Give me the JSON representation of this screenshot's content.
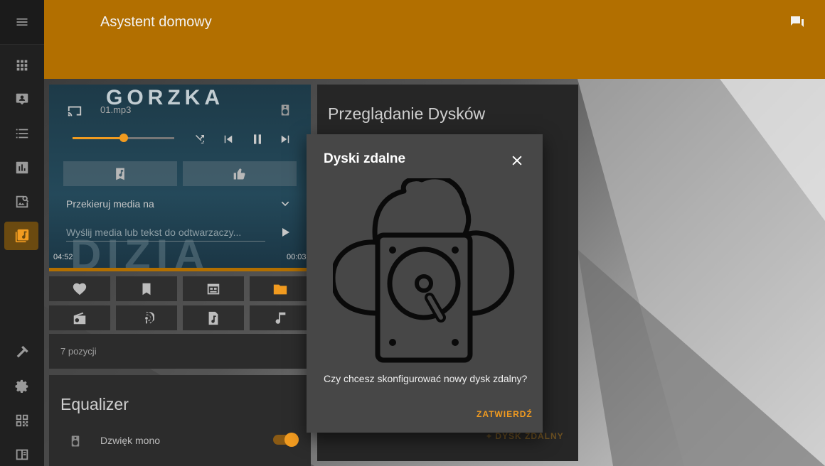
{
  "header": {
    "title": "Asystent domowy"
  },
  "player": {
    "cover_title": "GORZKA",
    "cover_bottom": "DIZIA",
    "file_name": "01.mp3",
    "progress": 0.5,
    "redirect_label": "Przekieruj media na",
    "send_placeholder": "Wyślij media lub tekst do odtwarzaczy...",
    "time_left": "04:52",
    "time_right": "00:03"
  },
  "positions": {
    "label": "7 pozycji"
  },
  "equalizer": {
    "title": "Equalizer",
    "mono_label": "Dzwięk mono",
    "mono_on": true
  },
  "disks": {
    "title": "Przeglądanie Dysków",
    "add_label": "+ DYSK ZDALNY"
  },
  "dialog": {
    "title": "Dyski zdalne",
    "question": "Czy chcesz skonfigurować nowy dysk zdalny?",
    "confirm_label": "ZATWIERDŹ"
  },
  "colors": {
    "accent": "#f19b20",
    "header": "#b26f00",
    "sidebar": "#202020",
    "dialog": "#474747"
  },
  "icons": {
    "sidebar": [
      "menu-icon",
      "apps-icon",
      "screen-share-icon",
      "list-icon",
      "chart-icon",
      "image-search-icon",
      "library-music-icon",
      "hammer-icon",
      "gear-icon",
      "qr-code-icon",
      "book-icon"
    ],
    "grid": [
      "heart-icon",
      "bookmark-icon",
      "calendar-view-icon",
      "folder-icon",
      "radio-icon",
      "podcast-icon",
      "music-file-icon",
      "music-note-icon"
    ]
  }
}
